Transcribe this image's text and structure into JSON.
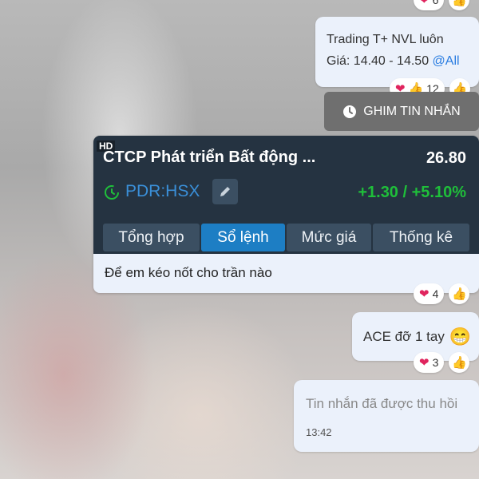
{
  "messages": {
    "top_reaction": {
      "count": "6"
    },
    "trading": {
      "line1": "Trading T+ NVL luôn",
      "line2": "Giá: 14.40 - 14.50",
      "mention": "@All",
      "reactions": {
        "count": "12"
      }
    },
    "pin_button": {
      "label": "GHIM TIN NHẮN",
      "icon": "clock-icon"
    },
    "stock_card": {
      "badge": "HD",
      "name": "CTCP Phát triển Bất động ...",
      "price": "26.80",
      "ticker": "PDR:HSX",
      "change": "+1.30 / +5.10%",
      "change_color": "#1fbf3a",
      "tabs": [
        {
          "label": "Tổng hợp"
        },
        {
          "label": "Sổ lệnh"
        },
        {
          "label": "Mức giá"
        },
        {
          "label": "Thống kê"
        }
      ],
      "active_tab": "Sổ lệnh",
      "caption": "Để em kéo nốt cho trần nào",
      "reactions": {
        "count": "4"
      }
    },
    "ace": {
      "text": "ACE đỡ 1 tay",
      "emoji": "😁",
      "reactions": {
        "count": "3"
      }
    },
    "recalled": {
      "text": "Tin nhắn đã được thu hồi",
      "time": "13:42"
    }
  },
  "colors": {
    "bubble": "#ebf1fb",
    "card": "#253341",
    "active_tab": "#1d7ec4",
    "mention": "#2a7de1"
  }
}
